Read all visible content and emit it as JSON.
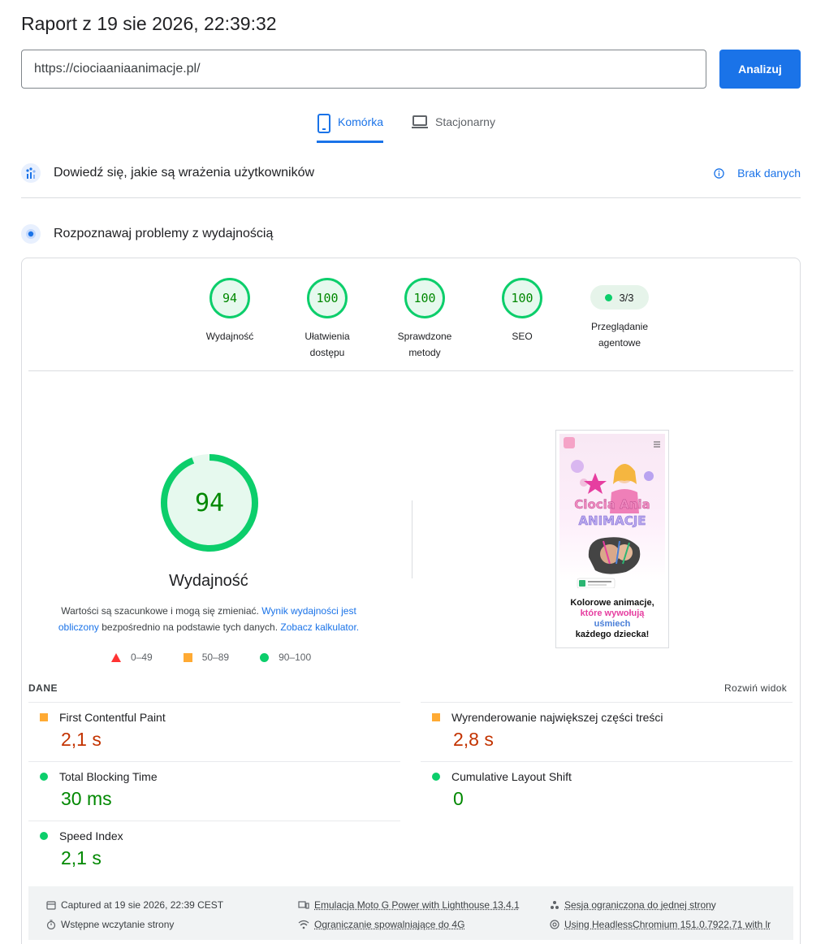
{
  "report": {
    "title": "Raport z 19 sie 2026, 22:39:32",
    "url_value": "https://ciociaaniaanimacje.pl/",
    "analyze_label": "Analizuj"
  },
  "tabs": [
    {
      "label": "Komórka",
      "active": true,
      "icon": "phone-icon"
    },
    {
      "label": "Stacjonarny",
      "active": false,
      "icon": "laptop-icon"
    }
  ],
  "sections": {
    "user_experience": {
      "label": "Dowiedź się, jakie są wrażenia użytkowników",
      "no_data": "Brak danych"
    },
    "performance": {
      "label": "Rozpoznawaj problemy z wydajnością"
    }
  },
  "scores": [
    {
      "value": "94",
      "label_lines": [
        "Wydajność"
      ]
    },
    {
      "value": "100",
      "label_lines": [
        "Ułatwienia",
        "dostępu"
      ]
    },
    {
      "value": "100",
      "label_lines": [
        "Sprawdzone",
        "metody"
      ]
    },
    {
      "value": "100",
      "label_lines": [
        "SEO"
      ]
    },
    {
      "value": "3/3",
      "label_lines": [
        "Przeglądanie",
        "agentowe"
      ]
    }
  ],
  "main_score": {
    "value": "94",
    "fraction": 0.94,
    "label": "Wydajność",
    "desc_1": "Wartości są szacunkowe i mogą się zmieniać. ",
    "link_1": "Wynik wydajności jest obliczony",
    "desc_2": " bezpośrednio na podstawie tych danych. ",
    "link_2": "Zobacz kalkulator.",
    "legend": [
      "0–49",
      "50–89",
      "90–100"
    ]
  },
  "screenshot": {
    "headline_1": "Kolorowe animacje,",
    "headline_2": "które wywołują",
    "headline_3": "uśmiech",
    "headline_4": "każdego dziecka!"
  },
  "metrics_header": {
    "label": "DANE",
    "expand": "Rozwiń widok"
  },
  "metrics": [
    {
      "name": "First Contentful Paint",
      "value": "2,1 s",
      "status": "average"
    },
    {
      "name": "Wyrenderowanie największej części treści",
      "value": "2,8 s",
      "status": "average"
    },
    {
      "name": "Total Blocking Time",
      "value": "30 ms",
      "status": "pass"
    },
    {
      "name": "Cumulative Layout Shift",
      "value": "0",
      "status": "pass"
    },
    {
      "name": "Speed Index",
      "value": "2,1 s",
      "status": "pass"
    }
  ],
  "footer": {
    "captured": "Captured at 19 sie 2026, 22:39 CEST",
    "emulation": "Emulacja Moto G Power with Lighthouse 13.4.1",
    "session": "Sesja ograniczona do jednej strony",
    "load": "Wstępne wczytanie strony",
    "throttle": "Ograniczanie spowalniające do 4G",
    "browser": "Using HeadlessChromium 151.0.7922.71 with lr"
  },
  "colors": {
    "accent": "#1a73e8",
    "pass": "#0cce6b",
    "average": "#ffaa33",
    "fail": "#ff3333"
  }
}
